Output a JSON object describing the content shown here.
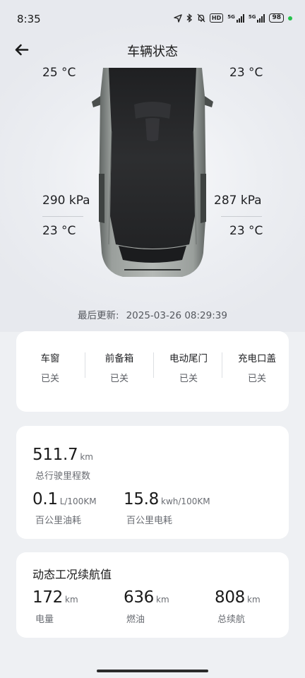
{
  "status_bar": {
    "time": "8:35",
    "hd": "HD",
    "net1": "5G",
    "net2": "5G",
    "battery": "98"
  },
  "header": {
    "title": "车辆状态"
  },
  "tires": {
    "front_left_temp": "25 °C",
    "front_right_temp": "23 °C",
    "rear_left_pressure": "290 kPa",
    "rear_right_pressure": "287 kPa",
    "rear_left_temp": "23 °C",
    "rear_right_temp": "23 °C"
  },
  "last_update": {
    "label": "最后更新:",
    "value": "2025-03-26 08:29:39"
  },
  "closures": [
    {
      "name": "车窗",
      "state": "已关"
    },
    {
      "name": "前备箱",
      "state": "已关"
    },
    {
      "name": "电动尾门",
      "state": "已关"
    },
    {
      "name": "充电口盖",
      "state": "已关"
    }
  ],
  "stats": {
    "odometer": {
      "value": "511.7",
      "unit": "km",
      "label": "总行驶里程数"
    },
    "fuel_consumption": {
      "value": "0.1",
      "unit": "L/100KM",
      "label": "百公里油耗"
    },
    "power_consumption": {
      "value": "15.8",
      "unit": "kwh/100KM",
      "label": "百公里电耗"
    }
  },
  "range": {
    "title": "动态工况续航值",
    "electric": {
      "value": "172",
      "unit": "km",
      "label": "电量"
    },
    "fuel": {
      "value": "636",
      "unit": "km",
      "label": "燃油"
    },
    "total": {
      "value": "808",
      "unit": "km",
      "label": "总续航"
    }
  },
  "colors": {
    "car_body": "#8e9390",
    "car_glass": "#2b2c2e",
    "accent_green": "#27c24c"
  }
}
